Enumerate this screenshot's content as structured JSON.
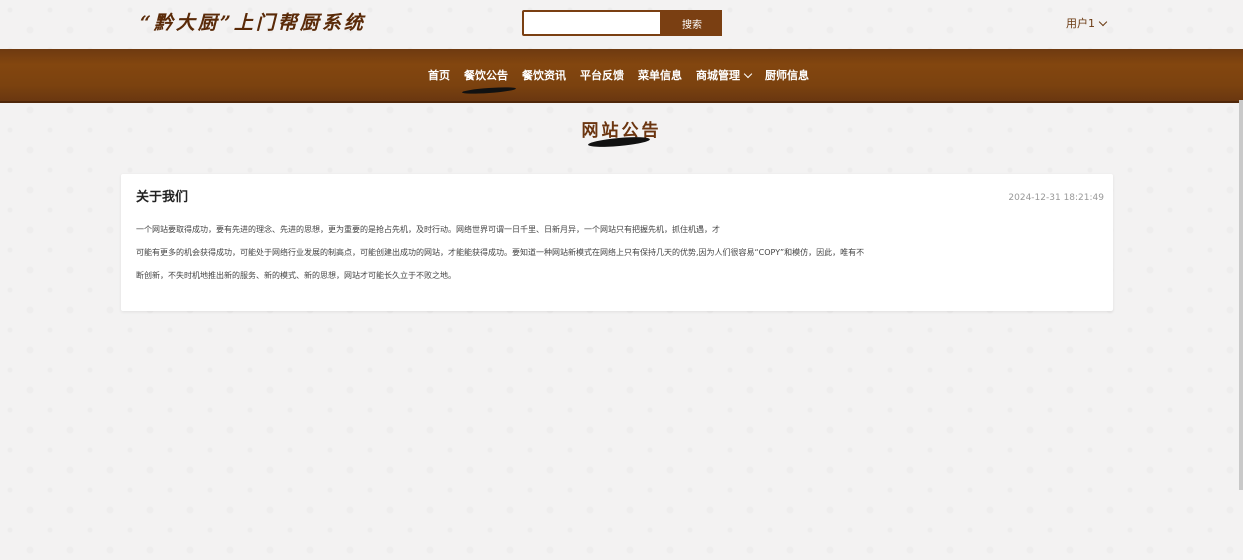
{
  "header": {
    "logo_text": "“黔大厨”上门帮厨系统",
    "search_placeholder": "",
    "search_button": "搜索",
    "user_label": "用户1"
  },
  "nav": {
    "items": [
      "首页",
      "餐饮公告",
      "餐饮资讯",
      "平台反馈",
      "菜单信息",
      "商城管理",
      "厨师信息"
    ],
    "active_index": 1
  },
  "page": {
    "title": "网站公告"
  },
  "article": {
    "title": "关于我们",
    "date": "2024-12-31 18:21:49",
    "lines": [
      "一个网站要取得成功，要有先进的理念、先进的思想，更为重要的是抢占先机，及时行动。网络世界可谓一日千里、日新月异，一个网站只有把握先机，抓住机遇，才",
      "可能有更多的机会获得成功，可能处于网络行业发展的制高点，可能创建出成功的网站，才能能获得成功。要知道一种网站新模式在网络上只有保持几天的优势,因为人们很容易“COPY”和模仿，因此，唯有不",
      "断创新，不失时机地推出新的服务、新的模式、新的思想，网站才可能长久立于不败之地。"
    ]
  },
  "colors": {
    "brand_brown": "#7a3f12",
    "nav_bg": "#7b420f",
    "page_bg": "#f3f2f2"
  }
}
